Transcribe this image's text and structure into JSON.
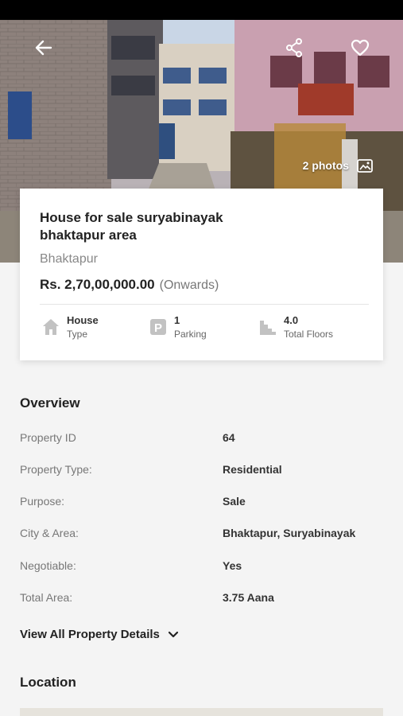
{
  "header": {
    "photos_label": "2 photos",
    "icons": {
      "back": "arrow-left-icon",
      "share": "share-icon",
      "favorite": "heart-icon",
      "photos": "gallery-icon"
    }
  },
  "listing": {
    "title": "House for sale suryabinayak bhaktapur area",
    "city": "Bhaktapur",
    "price": "Rs.  2,70,00,000.00",
    "price_note": "(Onwards)",
    "features": [
      {
        "value": "House",
        "label": "Type",
        "icon": "house-icon"
      },
      {
        "value": "1",
        "label": "Parking",
        "icon": "parking-icon"
      },
      {
        "value": "4.0",
        "label": "Total Floors",
        "icon": "floors-icon"
      }
    ]
  },
  "overview": {
    "title": "Overview",
    "rows": [
      {
        "label": "Property ID",
        "value": "64"
      },
      {
        "label": "Property Type:",
        "value": "Residential"
      },
      {
        "label": "Purpose:",
        "value": "Sale"
      },
      {
        "label": "City & Area:",
        "value": "Bhaktapur, Suryabinayak"
      },
      {
        "label": "Negotiable:",
        "value": "Yes"
      },
      {
        "label": "Total Area:",
        "value": "3.75 Aana"
      }
    ],
    "view_all": "View All Property Details"
  },
  "location": {
    "title": "Location"
  },
  "colors": {
    "icon_gray": "#bdbdbd",
    "text_dark": "#222222",
    "text_muted": "#777777"
  }
}
